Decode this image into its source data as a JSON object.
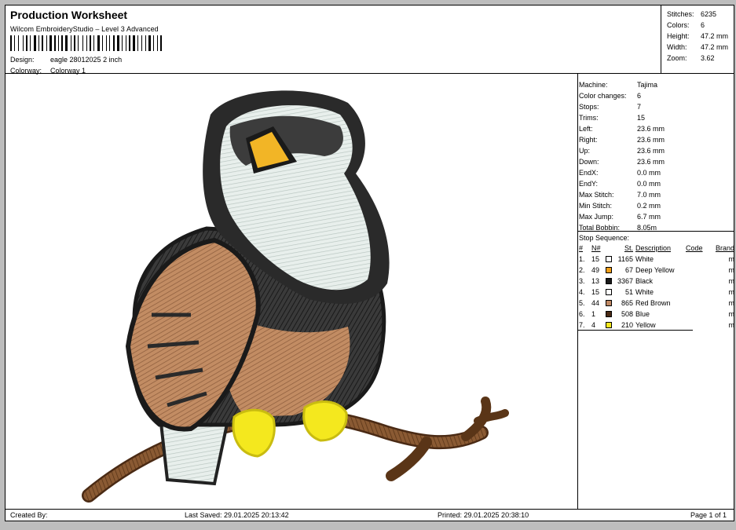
{
  "header": {
    "title": "Production Worksheet",
    "software": "Wilcom EmbroideryStudio – Level 3 Advanced",
    "design_label": "Design:",
    "design_value": "eagle 28012025 2 inch",
    "colorway_label": "Colorway:",
    "colorway_value": "Colorway 1"
  },
  "stats": [
    {
      "label": "Stitches:",
      "value": "6235"
    },
    {
      "label": "Colors:",
      "value": "6"
    },
    {
      "label": "Height:",
      "value": "47.2 mm"
    },
    {
      "label": "Width:",
      "value": "47.2 mm"
    },
    {
      "label": "Zoom:",
      "value": "3.62"
    }
  ],
  "info": [
    {
      "label": "Machine:",
      "value": "Tajima"
    },
    {
      "label": "Color changes:",
      "value": "6"
    },
    {
      "label": "Stops:",
      "value": "7"
    },
    {
      "label": "Trims:",
      "value": "15"
    },
    {
      "label": "Left:",
      "value": "23.6 mm"
    },
    {
      "label": "Right:",
      "value": "23.6 mm"
    },
    {
      "label": "Up:",
      "value": "23.6 mm"
    },
    {
      "label": "Down:",
      "value": "23.6 mm"
    },
    {
      "label": "EndX:",
      "value": "0.0 mm"
    },
    {
      "label": "EndY:",
      "value": "0.0 mm"
    },
    {
      "label": "Max Stitch:",
      "value": "7.0 mm"
    },
    {
      "label": "Min Stitch:",
      "value": "0.2 mm"
    },
    {
      "label": "Max Jump:",
      "value": "6.7 mm"
    },
    {
      "label": "Total Bobbin:",
      "value": "8.05m"
    }
  ],
  "sequence": {
    "heading": "Stop Sequence:",
    "columns": {
      "num": "#",
      "n": "N#",
      "st": "St.",
      "desc": "Description",
      "code": "Code",
      "brand": "Brand"
    },
    "rows": [
      {
        "num": "1.",
        "n": "15",
        "color": "#ffffff",
        "st": "1165",
        "desc": "White",
        "brand": "m"
      },
      {
        "num": "2.",
        "n": "49",
        "color": "#f2a01a",
        "st": "67",
        "desc": "Deep Yellow",
        "brand": "m"
      },
      {
        "num": "3.",
        "n": "13",
        "color": "#1a1a1a",
        "st": "3367",
        "desc": "Black",
        "brand": "m"
      },
      {
        "num": "4.",
        "n": "15",
        "color": "#ffffff",
        "st": "51",
        "desc": "White",
        "brand": "m"
      },
      {
        "num": "5.",
        "n": "44",
        "color": "#c08a65",
        "st": "865",
        "desc": "Red Brown",
        "brand": "m"
      },
      {
        "num": "6.",
        "n": "1",
        "color": "#4a2a14",
        "st": "508",
        "desc": "Blue",
        "brand": "m"
      },
      {
        "num": "7.",
        "n": "4",
        "color": "#f4e81e",
        "st": "210",
        "desc": "Yellow",
        "brand": "m"
      }
    ]
  },
  "footer": {
    "created": "Created By:",
    "saved": "Last Saved: 29.01.2025 20:13:42",
    "printed": "Printed: 29.01.2025 20:38:10",
    "page": "Page 1 of 1"
  }
}
